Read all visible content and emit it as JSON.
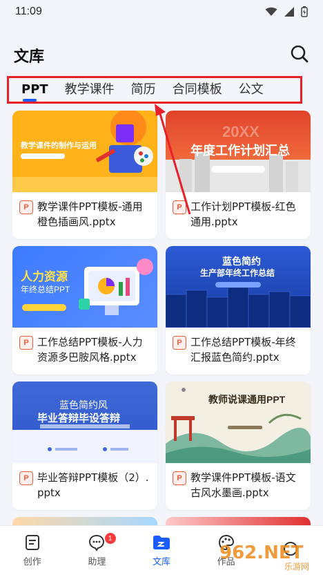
{
  "status": {
    "time": "11:09"
  },
  "header": {
    "title": "文库"
  },
  "tabs": [
    {
      "label": "PPT",
      "active": true
    },
    {
      "label": "教学课件",
      "active": false
    },
    {
      "label": "简历",
      "active": false
    },
    {
      "label": "合同模板",
      "active": false
    },
    {
      "label": "公文",
      "active": false
    }
  ],
  "cards": [
    {
      "title": "教学课件PPT模板-通用橙色插画风.pptx",
      "thumb_heading": "教学课件的制作与运用",
      "thumb_sub": ""
    },
    {
      "title": "工作计划PPT模板-红色通用.pptx",
      "thumb_heading": "年度工作计划汇总",
      "thumb_sub": "20XX"
    },
    {
      "title": "工作总结PPT模板-人力资源多巴胺风格.pptx",
      "thumb_heading": "人力资源",
      "thumb_sub": "年终总结PPT"
    },
    {
      "title": "工作总结PPT模板-年终汇报蓝色简约.pptx",
      "thumb_heading": "蓝色简约",
      "thumb_sub": "生产部年终工作总结"
    },
    {
      "title": "毕业答辩PPT模板（2）.pptx",
      "thumb_heading": "蓝色简约风",
      "thumb_sub": "毕业答辩毕设答辩"
    },
    {
      "title": "教学课件PPT模板-语文古风水墨画.pptx",
      "thumb_heading": "教师说课通用PPT",
      "thumb_sub": ""
    }
  ],
  "nav": [
    {
      "label": "创作",
      "icon": "document-icon",
      "active": false
    },
    {
      "label": "助理",
      "icon": "chat-icon",
      "active": false,
      "badge": "1"
    },
    {
      "label": "文库",
      "icon": "folder-icon",
      "active": true
    },
    {
      "label": "作品",
      "icon": "palette-icon",
      "active": false
    },
    {
      "label": "",
      "icon": "profile-icon",
      "active": false
    }
  ],
  "watermark": {
    "text": "962.NET",
    "sub": "乐游网"
  },
  "colors": {
    "accent": "#1a5cff",
    "annotation": "#e8202a",
    "badge": "#ff3b3b"
  }
}
